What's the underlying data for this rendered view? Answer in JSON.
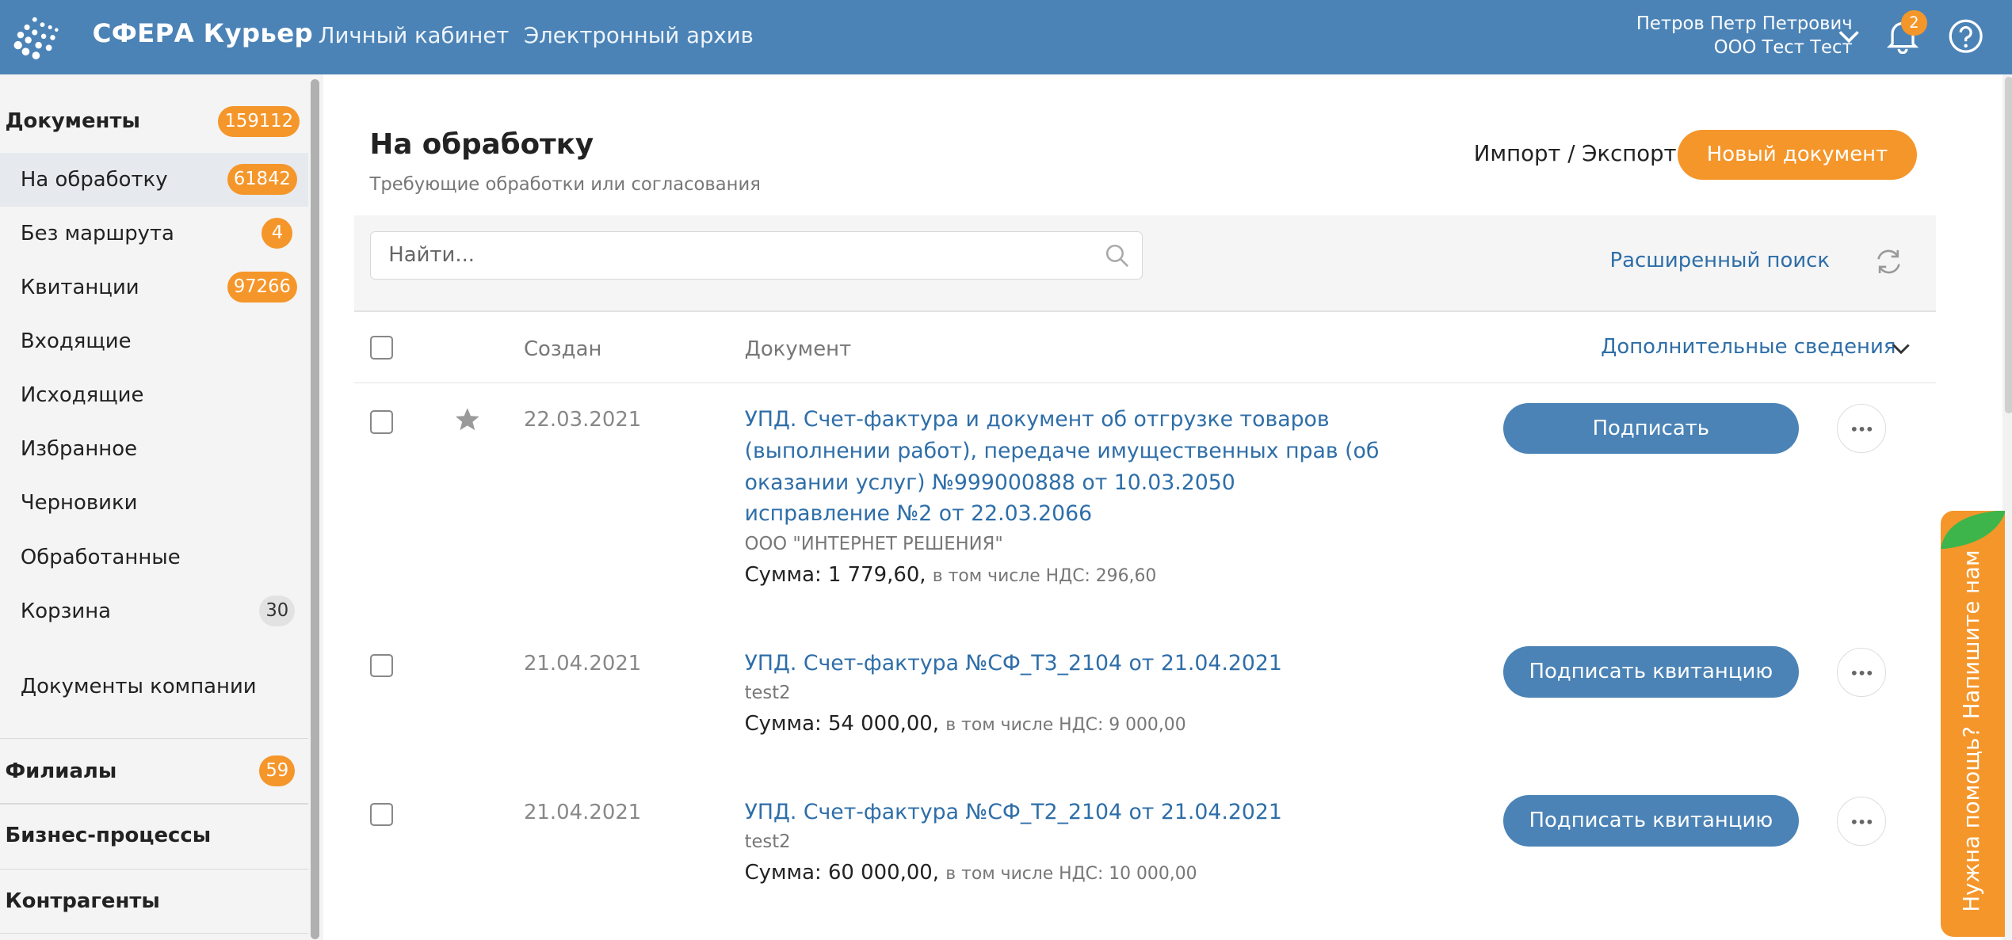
{
  "header": {
    "brand": "СФЕРА Курьер",
    "nav": [
      "Личный кабинет",
      "Электронный архив"
    ],
    "user_name": "Петров Петр Петрович",
    "user_org": "ООО Тест Тест",
    "notifications": "2"
  },
  "sidebar": {
    "documents_label": "Документы",
    "documents_count": "159112",
    "items": [
      {
        "label": "На обработку",
        "count": "61842"
      },
      {
        "label": "Без маршрута",
        "count": "4"
      },
      {
        "label": "Квитанции",
        "count": "97266"
      },
      {
        "label": "Входящие"
      },
      {
        "label": "Исходящие"
      },
      {
        "label": "Избранное"
      },
      {
        "label": "Черновики"
      },
      {
        "label": "Обработанные"
      },
      {
        "label": "Корзина",
        "count": "30"
      }
    ],
    "company_docs": "Документы компании",
    "branches_label": "Филиалы",
    "branches_count": "59",
    "business_label": "Бизнес-процессы",
    "contractors_label": "Контрагенты"
  },
  "main": {
    "title": "На обработку",
    "subtitle": "Требующие обработки или согласования",
    "import_export": "Импорт / Экспорт",
    "new_document": "Новый документ",
    "search_placeholder": "Найти...",
    "advanced_search": "Расширенный поиск",
    "col_created": "Создан",
    "col_document": "Документ",
    "extra_info": "Дополнительные сведения"
  },
  "rows": [
    {
      "date": "22.03.2021",
      "title": "УПД. Счет-фактура и документ об отгрузке товаров (выполнении работ), передаче имущественных прав (об оказании услуг) №999000888 от 10.03.2050 исправление №2 от 22.03.2066",
      "org": "ООО \"ИНТЕРНЕТ РЕШЕНИЯ\"",
      "sum": "Сумма: 1 779,60,",
      "vat": "в том числе НДС: 296,60",
      "action": "Подписать"
    },
    {
      "date": "21.04.2021",
      "title": "УПД. Счет-фактура №СФ_Т3_2104 от 21.04.2021",
      "org": "test2",
      "sum": "Сумма: 54 000,00,",
      "vat": "в том числе НДС: 9 000,00",
      "action": "Подписать квитанцию"
    },
    {
      "date": "21.04.2021",
      "title": "УПД. Счет-фактура №СФ_Т2_2104 от 21.04.2021",
      "org": "test2",
      "sum": "Сумма: 60 000,00,",
      "vat": "в том числе НДС: 10 000,00",
      "action": "Подписать квитанцию"
    }
  ],
  "help_widget": "Нужна помощь? Напишите нам"
}
